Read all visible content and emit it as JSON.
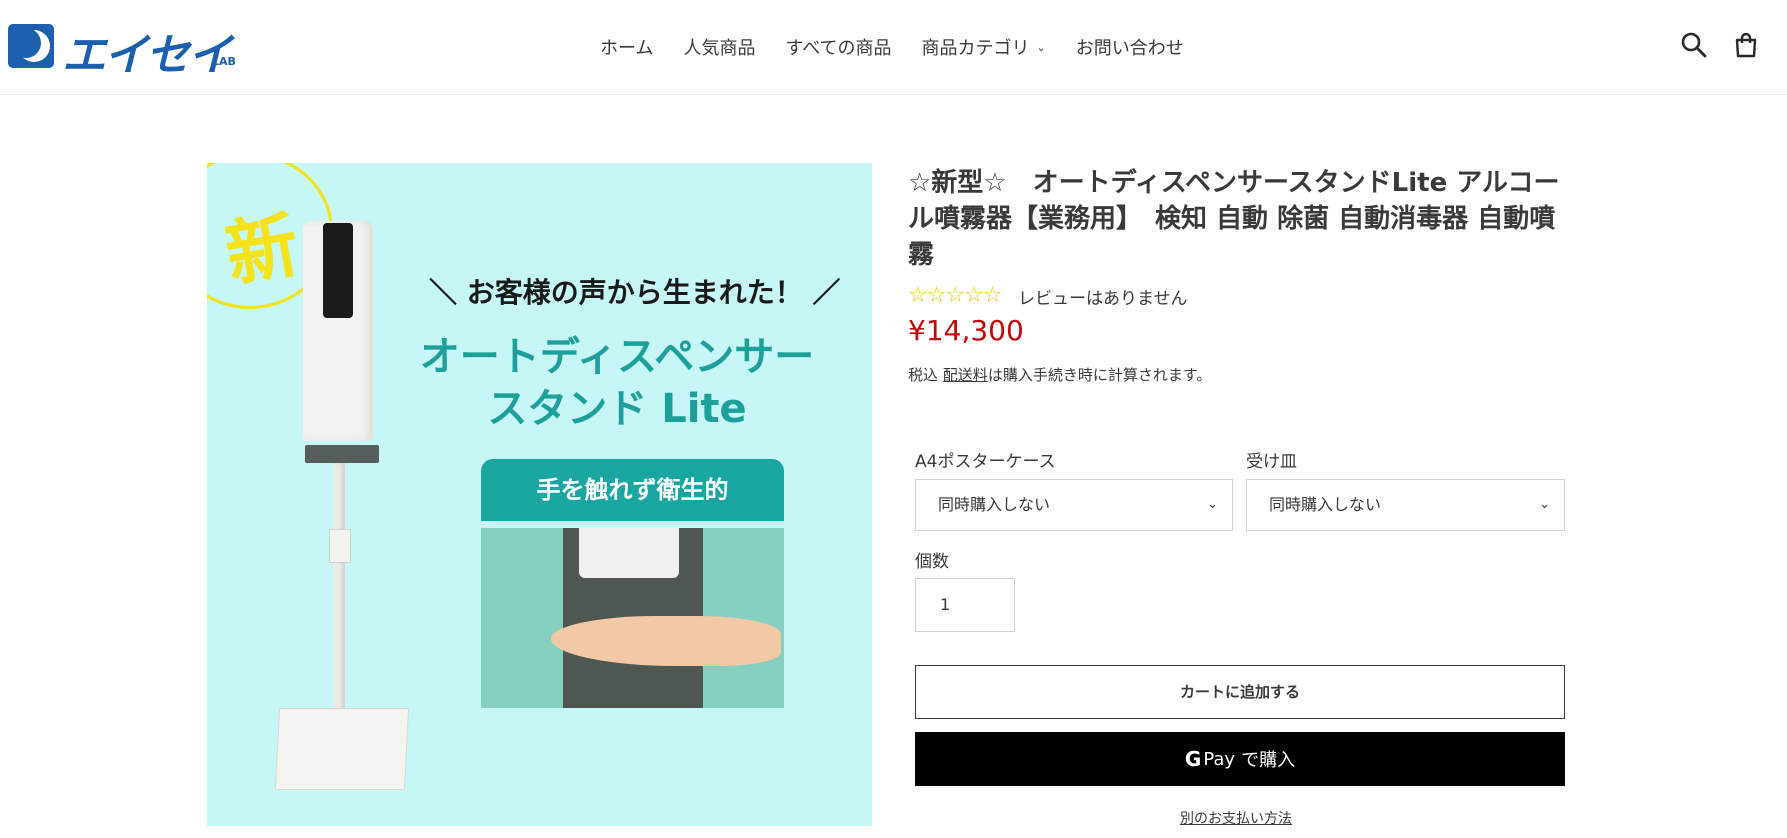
{
  "header": {
    "logo_text": "エイセイ",
    "logo_sub": "LAB",
    "nav": [
      "ホーム",
      "人気商品",
      "すべての商品",
      "商品カテゴリ",
      "お問い合わせ"
    ],
    "icons": [
      "search-icon",
      "cart-icon"
    ]
  },
  "product_image": {
    "stamp": "新",
    "tagline": "＼ お客様の声から生まれた！ ／",
    "headline_line1": "オートディスペンサー",
    "headline_line2": "スタンド Lite",
    "badge": "手を触れず衛生的"
  },
  "product": {
    "title": "☆新型☆　オートディスペンサースタンドLite アルコール噴霧器【業務用】　検知 自動 除菌 自動消毒器 自動噴霧",
    "stars": "☆☆☆☆☆",
    "rating": 0,
    "review_text": "レビューはありません",
    "price": "¥14,300",
    "tax_prefix": "税込",
    "shipping_link": "配送料",
    "tax_suffix": "は購入手続き時に計算されます。"
  },
  "options": {
    "option1_label": "A4ポスターケース",
    "option1_value": "同時購入しない",
    "option2_label": "受け皿",
    "option2_value": "同時購入しない",
    "qty_label": "個数",
    "qty_value": "1"
  },
  "buttons": {
    "add_to_cart": "カートに追加する",
    "gpay_g": "G",
    "gpay_pay": "Pay",
    "gpay_suffix": "で購入",
    "other_payment": "別のお支払い方法"
  },
  "colors": {
    "brand_blue": "#1b5fae",
    "price_red": "#c2070c",
    "teal": "#1aa6a0",
    "image_bg": "#c6f6f6"
  }
}
